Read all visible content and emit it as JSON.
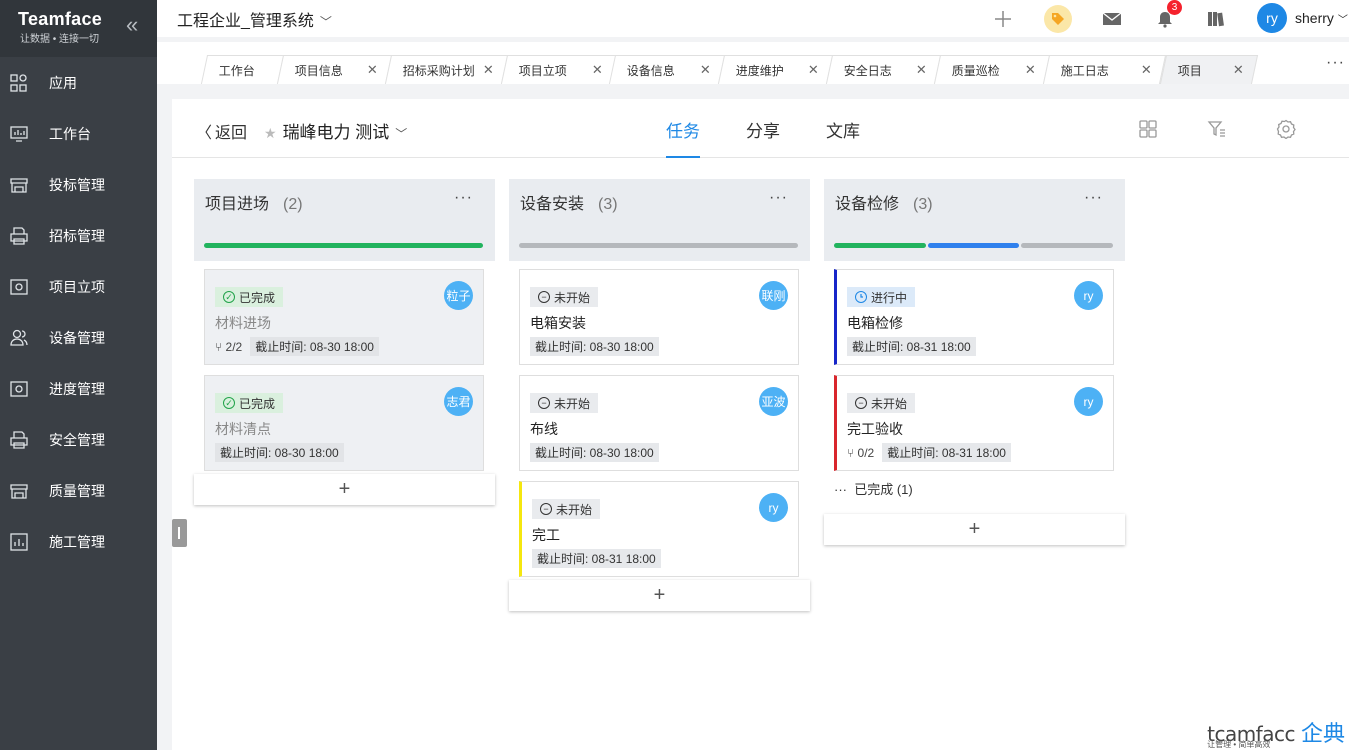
{
  "sidebar": {
    "brand": "Teamface",
    "slogan": "让数据 • 连接一切",
    "items": [
      {
        "label": "应用",
        "icon": "grid-icon"
      },
      {
        "label": "工作台",
        "icon": "dashboard-icon"
      },
      {
        "label": "投标管理",
        "icon": "store-icon"
      },
      {
        "label": "招标管理",
        "icon": "printer-icon"
      },
      {
        "label": "项目立项",
        "icon": "safe-icon"
      },
      {
        "label": "设备管理",
        "icon": "users-icon"
      },
      {
        "label": "进度管理",
        "icon": "safe-icon"
      },
      {
        "label": "安全管理",
        "icon": "printer-icon"
      },
      {
        "label": "质量管理",
        "icon": "store-icon"
      },
      {
        "label": "施工管理",
        "icon": "report-icon"
      }
    ]
  },
  "topbar": {
    "system_title": "工程企业_管理系统",
    "notification_count": "3",
    "user_initials": "ry",
    "user_name": "sherry"
  },
  "tabs": [
    {
      "label": "工作台",
      "closable": false
    },
    {
      "label": "项目信息",
      "closable": true
    },
    {
      "label": "招标采购计划",
      "closable": true
    },
    {
      "label": "项目立项",
      "closable": true
    },
    {
      "label": "设备信息",
      "closable": true
    },
    {
      "label": "进度维护",
      "closable": true
    },
    {
      "label": "安全日志",
      "closable": true
    },
    {
      "label": "质量巡检",
      "closable": true
    },
    {
      "label": "施工日志",
      "closable": true
    },
    {
      "label": "项目",
      "closable": true,
      "active": true
    }
  ],
  "header": {
    "back_label": "返回",
    "project_name": "瑞峰电力 测试",
    "view_tabs": [
      "任务",
      "分享",
      "文库"
    ],
    "active_view": "任务"
  },
  "columns": [
    {
      "title": "项目进场",
      "count": "(2)",
      "progress": [
        {
          "color": "#22b35e",
          "fraction": 1.0
        }
      ],
      "cards": [
        {
          "status": "已完成",
          "status_type": "done",
          "title": "材料进场",
          "subtasks": "2/2",
          "deadline": "截止时间: 08-30 18:00",
          "assignee": "粒子",
          "stripe": ""
        },
        {
          "status": "已完成",
          "status_type": "done",
          "title": "材料清点",
          "subtasks": "",
          "deadline": "截止时间: 08-30 18:00",
          "assignee": "志君",
          "stripe": ""
        }
      ],
      "completed_link": ""
    },
    {
      "title": "设备安装",
      "count": "(3)",
      "progress": [
        {
          "color": "#b5b8bc",
          "fraction": 1.0
        }
      ],
      "cards": [
        {
          "status": "未开始",
          "status_type": "todo",
          "title": "电箱安装",
          "subtasks": "",
          "deadline": "截止时间: 08-30 18:00",
          "assignee": "联刚",
          "stripe": ""
        },
        {
          "status": "未开始",
          "status_type": "todo",
          "title": "布线",
          "subtasks": "",
          "deadline": "截止时间: 08-30 18:00",
          "assignee": "亚波",
          "stripe": ""
        },
        {
          "status": "未开始",
          "status_type": "todo",
          "title": "完工",
          "subtasks": "",
          "deadline": "截止时间: 08-31 18:00",
          "assignee": "ry",
          "stripe": "#f5e70f"
        }
      ],
      "completed_link": ""
    },
    {
      "title": "设备检修",
      "count": "(3)",
      "progress": [
        {
          "color": "#22b35e",
          "fraction": 0.333
        },
        {
          "color": "#2f80ed",
          "fraction": 0.333
        },
        {
          "color": "#b5b8bc",
          "fraction": 0.334
        }
      ],
      "cards": [
        {
          "status": "进行中",
          "status_type": "doing",
          "title": "电箱检修",
          "subtasks": "",
          "deadline": "截止时间: 08-31 18:00",
          "assignee": "ry",
          "stripe": "#1726c9"
        },
        {
          "status": "未开始",
          "status_type": "todo",
          "title": "完工验收",
          "subtasks": "0/2",
          "deadline": "截止时间: 08-31 18:00",
          "assignee": "ry",
          "stripe": "#d9262c"
        }
      ],
      "completed_link": "已完成 (1)"
    }
  ],
  "brand_footer": {
    "logo": "tcamfacc",
    "cn": "企典",
    "tagline": "让管理 • 简单高效"
  }
}
